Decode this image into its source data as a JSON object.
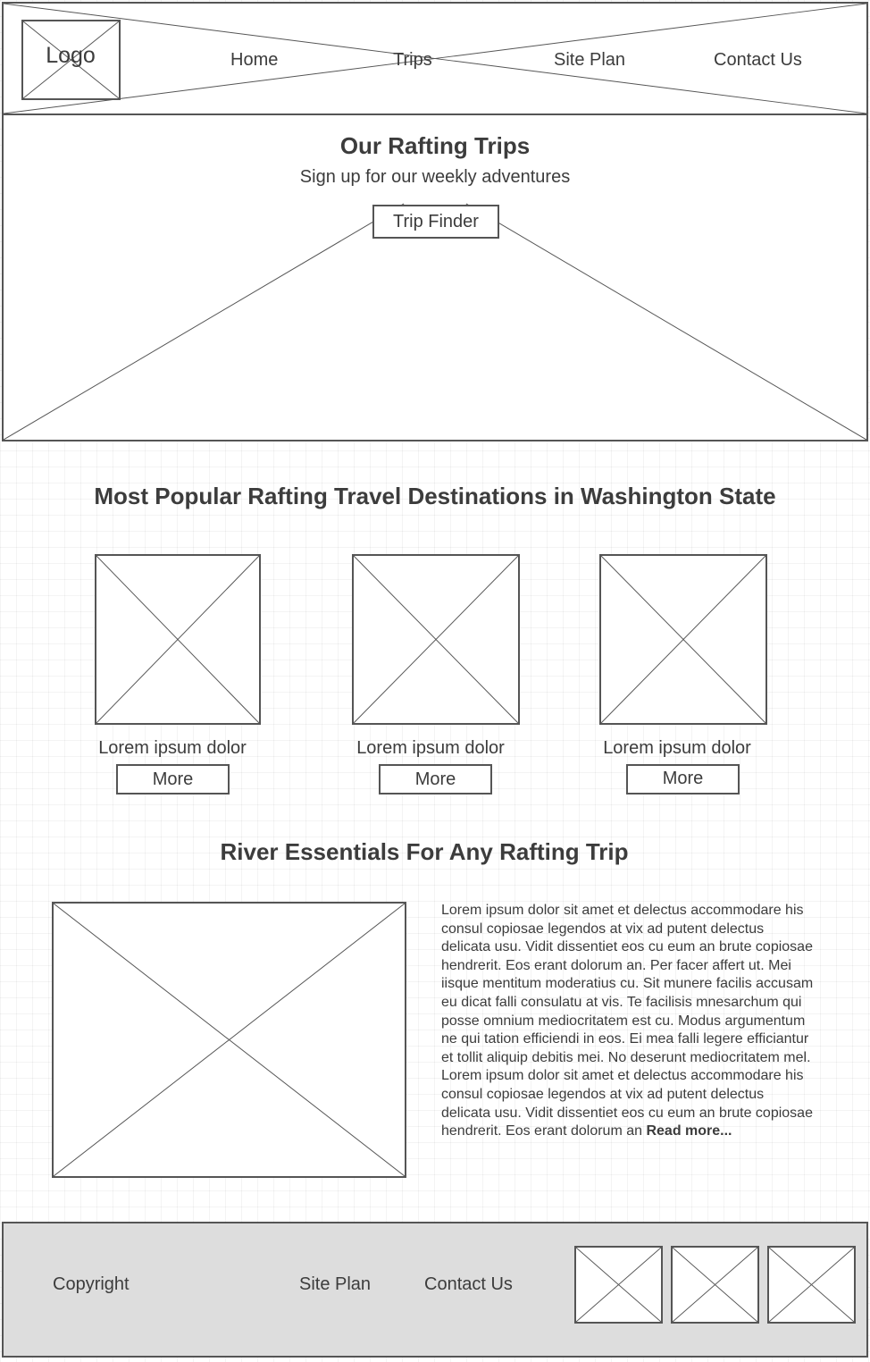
{
  "header": {
    "logo": "Logo",
    "nav": [
      "Home",
      "Trips",
      "Site Plan",
      "Contact Us"
    ]
  },
  "hero": {
    "title": "Our Rafting Trips",
    "subtitle": "Sign up for our weekly adventures",
    "button": "Trip Finder"
  },
  "popular": {
    "title": "Most Popular Rafting Travel Destinations in Washington State",
    "cards": [
      {
        "label": "Lorem ipsum dolor",
        "button": "More"
      },
      {
        "label": "Lorem ipsum dolor",
        "button": "More"
      },
      {
        "label": "Lorem ipsum dolor",
        "button": "More"
      }
    ]
  },
  "essentials": {
    "title": "River Essentials For Any Rafting Trip",
    "body": "Lorem ipsum dolor sit amet et delectus accommodare his consul copiosae legendos at vix ad putent delectus delicata usu. Vidit dissentiet eos cu eum an brute copiosae hendrerit. Eos erant dolorum an. Per facer affert ut. Mei iisque mentitum moderatius cu. Sit munere facilis accusam eu dicat falli consulatu at vis. Te facilisis mnesarchum qui posse omnium mediocritatem est cu. Modus argumentum ne qui tation efficiendi in eos. Ei mea falli legere efficiantur et tollit aliquip debitis mei. No deserunt mediocritatem mel. Lorem ipsum dolor sit amet et delectus accommodare his consul copiosae legendos at vix ad putent delectus delicata usu. Vidit dissentiet eos cu eum an brute copiosae hendrerit. Eos erant dolorum an",
    "read_more": "Read more..."
  },
  "footer": {
    "copyright": "Copyright",
    "site_plan": "Site Plan",
    "contact": "Contact Us"
  }
}
